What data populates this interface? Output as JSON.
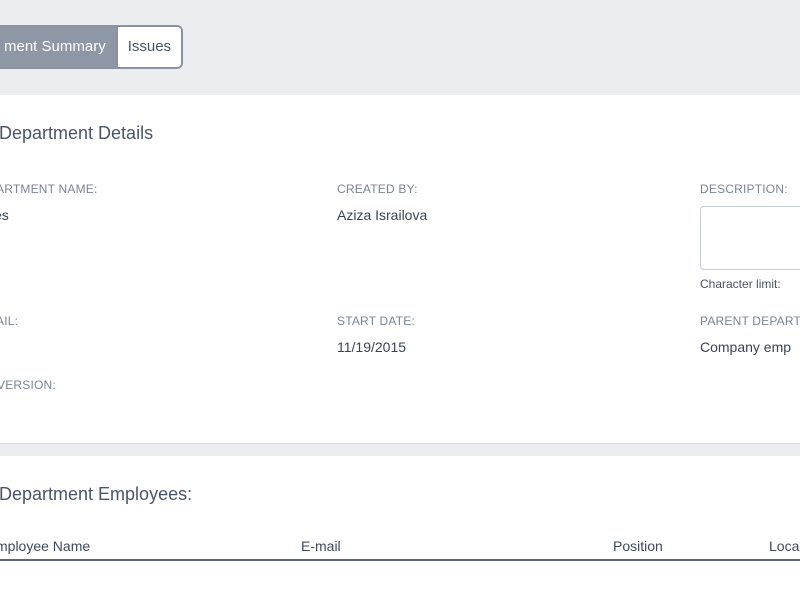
{
  "tabs": [
    {
      "label": "ment Summary",
      "active": true
    },
    {
      "label": "Issues",
      "active": false
    }
  ],
  "details": {
    "title": "Department Details",
    "department_name_label": "ARTMENT NAME:",
    "department_name_value": "es",
    "created_by_label": "CREATED BY:",
    "created_by_value": "Aziza Israilova",
    "description_label": "DESCRIPTION:",
    "description_value": "",
    "character_limit_label": "Character limit:",
    "email_label": "AIL:",
    "email_value": "",
    "start_date_label": "START DATE:",
    "start_date_value": "11/19/2015",
    "parent_department_label": "PARENT DEPART",
    "parent_department_value": "Company emp",
    "version_label": "VERSION:",
    "version_value": ""
  },
  "employees": {
    "title": "Department Employees:",
    "columns": [
      "mployee Name",
      "E-mail",
      "Position",
      "Loca"
    ]
  },
  "colors": {
    "page_bg": "#ebedf1",
    "card_bg": "#ffffff",
    "active_tab_bg": "#8e97a6",
    "tab_border": "#8892a3",
    "label_gray": "#7b8494",
    "text_dark": "#3a4454"
  }
}
